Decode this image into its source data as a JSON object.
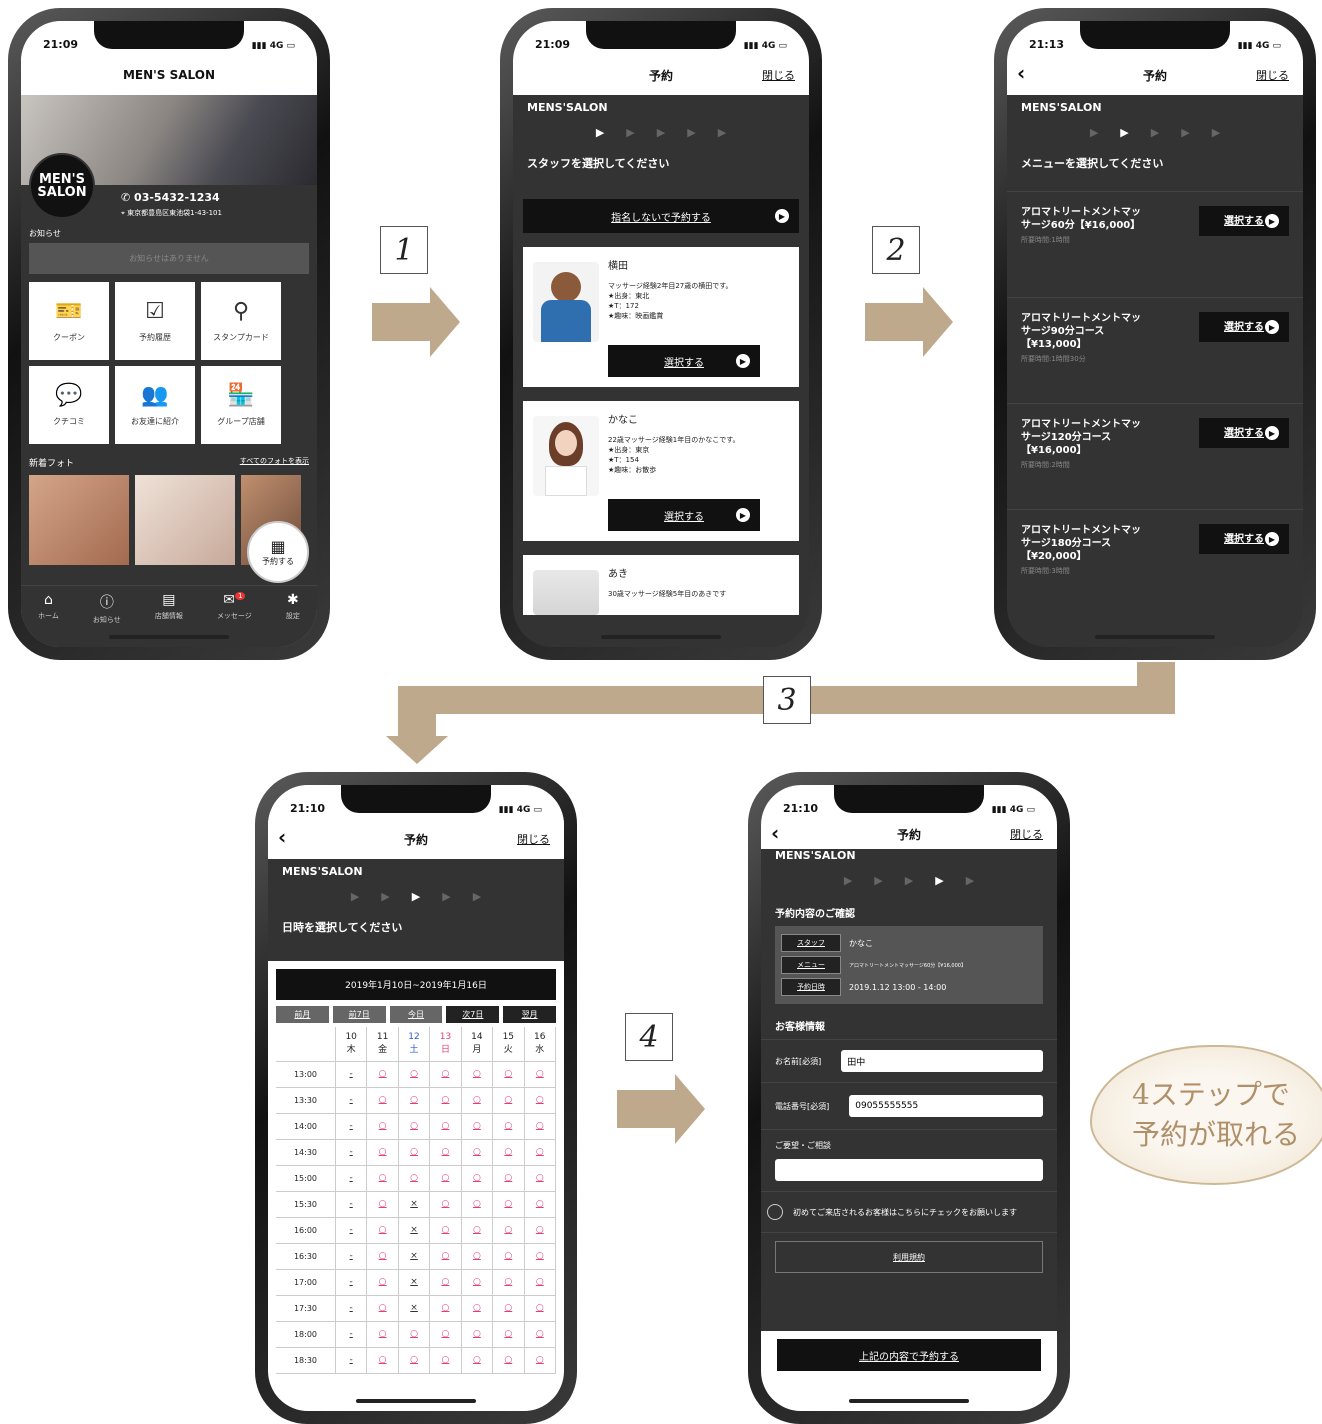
{
  "status_times": [
    "21:09",
    "21:09",
    "21:13",
    "21:10",
    "21:10"
  ],
  "network": "4G",
  "step_numbers": [
    "1",
    "2",
    "3",
    "4"
  ],
  "home": {
    "title": "MEN'S SALON",
    "logo": "MEN'S\nSALON",
    "phone": "03-5432-1234",
    "address": "東京都豊島区東池袋1-43-101",
    "notice_label": "お知らせ",
    "notice_empty": "お知らせはありません",
    "tiles": [
      "クーポン",
      "予約履歴",
      "スタンプカード",
      "クチコミ",
      "お友達に紹介",
      "グループ店舗"
    ],
    "photos_label": "新着フォト",
    "photos_link": "すべてのフォトを表示",
    "reserve_fab": "予約する",
    "tabs": [
      "ホーム",
      "お知らせ",
      "店舗情報",
      "メッセージ",
      "設定"
    ],
    "badge": "1"
  },
  "common": {
    "reserve_title": "予約",
    "close": "閉じる",
    "salon": "MENS'SALON",
    "select_btn": "選択する"
  },
  "staff_screen": {
    "instruction": "スタッフを選択してください",
    "no_nominate": "指名しないで予約する",
    "staff": [
      {
        "name": "横田",
        "desc": "マッサージ経験2年目27歳の横田です。\n★出身：東北\n★T：172\n★趣味：映画鑑賞"
      },
      {
        "name": "かなこ",
        "desc": "22歳マッサージ経験1年目のかなこです。\n★出身：東京\n★T：154\n★趣味：お散歩"
      },
      {
        "name": "あき",
        "desc": "30歳マッサージ経験5年目のあきです"
      }
    ]
  },
  "menu_screen": {
    "instruction": "メニューを選択してください",
    "menus": [
      {
        "title": "アロマトリートメントマッ\nサージ60分【¥16,000】",
        "duration": "所要時間:1時間"
      },
      {
        "title": "アロマトリートメントマッ\nサージ90分コース\n【¥13,000】",
        "duration": "所要時間:1時間30分"
      },
      {
        "title": "アロマトリートメントマッ\nサージ120分コース\n【¥16,000】",
        "duration": "所要時間:2時間"
      },
      {
        "title": "アロマトリートメントマッ\nサージ180分コース\n【¥20,000】",
        "duration": "所要時間:3時間"
      }
    ]
  },
  "date_screen": {
    "instruction": "日時を選択してください",
    "range": "2019年1月10日~2019年1月16日",
    "nav": [
      "前月",
      "前7日",
      "今日",
      "次7日",
      "翌月"
    ],
    "days": [
      [
        "10",
        "木"
      ],
      [
        "11",
        "金"
      ],
      [
        "12",
        "土"
      ],
      [
        "13",
        "日"
      ],
      [
        "14",
        "月"
      ],
      [
        "15",
        "火"
      ],
      [
        "16",
        "水"
      ]
    ],
    "times": [
      "13:00",
      "13:30",
      "14:00",
      "14:30",
      "15:00",
      "15:30",
      "16:00",
      "16:30",
      "17:00",
      "17:30",
      "18:00",
      "18:30"
    ],
    "cross_times": [
      "15:30",
      "16:00",
      "16:30",
      "17:00",
      "17:30"
    ]
  },
  "confirm_screen": {
    "section": "予約内容のご確認",
    "rows": [
      {
        "label": "スタッフ",
        "value": "かなこ"
      },
      {
        "label": "メニュー",
        "value": "アロマトリートメントマッサージ60分【¥16,000】"
      },
      {
        "label": "予約日時",
        "value": "2019.1.12 13:00 - 14:00"
      }
    ],
    "customer_section": "お客様情報",
    "name_label": "お名前[必須]",
    "name_value": "田中",
    "tel_label": "電話番号[必須]",
    "tel_value": "09055555555",
    "request_label": "ご要望・ご相談",
    "first_visit": "初めてご来店されるお客様はこちらにチェックをお願いします",
    "terms": "利用規約",
    "submit": "上記の内容で予約する"
  },
  "bubble": {
    "line1": "4ステップで",
    "line2": "予約が取れる"
  },
  "colors": {
    "accent": "#bfa98c",
    "dark": "#333333",
    "booking_mark": "#e0407a",
    "saturday": "#2a5fd0",
    "sunday": "#e0407a"
  }
}
